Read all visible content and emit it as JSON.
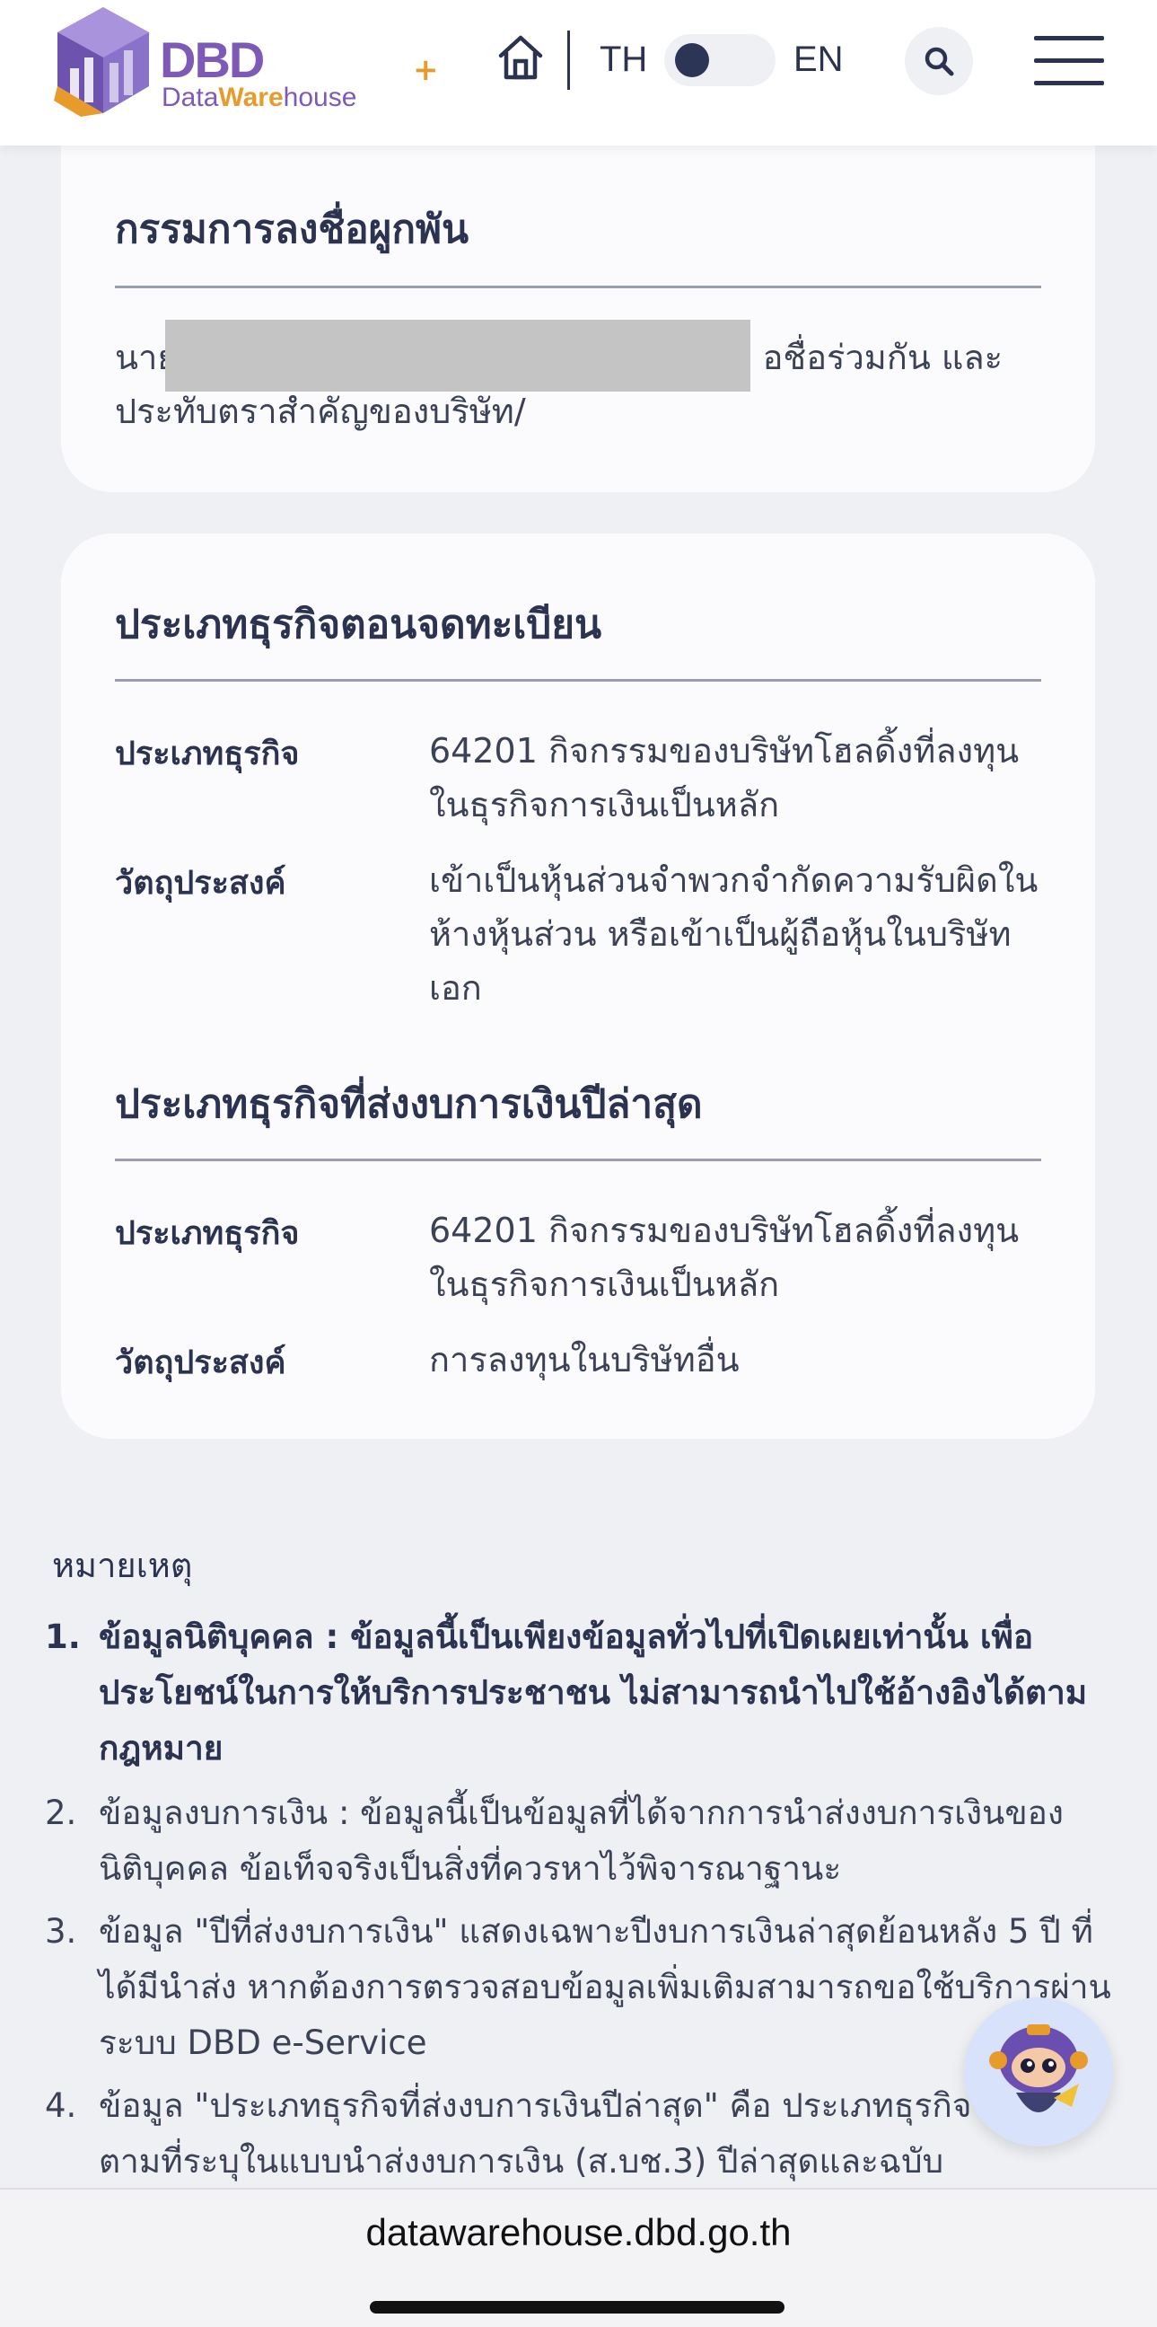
{
  "header": {
    "logo_dbd": "DBD",
    "logo_data": "ata",
    "logo_ware": "Ware",
    "logo_house": "house",
    "logo_plus": "+",
    "lang_th": "TH",
    "lang_en": "EN",
    "language_toggle_state": "TH"
  },
  "authorized_directors_card": {
    "title": "กรรมการลงชื่อผูกพัน",
    "text_prefix": "นาย",
    "text_suffix": "อชื่อร่วมกัน และ",
    "text_line2": "ประทับตราสำคัญของบริษัท/"
  },
  "business_type_card": {
    "registration_title": "ประเภทธุรกิจตอนจดทะเบียน",
    "registration_rows": [
      {
        "label": "ประเภทธุรกิจ",
        "value": "64201 กิจกรรมของบริษัทโฮลดิ้งที่ลงทุนในธุรกิจการเงินเป็นหลัก"
      },
      {
        "label": "วัตถุประสงค์",
        "value": "เข้าเป็นหุ้นส่วนจำพวกจำกัดความรับผิดในห้างหุ้นส่วน หรือเข้าเป็นผู้ถือหุ้นในบริษัทเอก"
      }
    ],
    "latest_title": "ประเภทธุรกิจที่ส่งงบการเงินปีล่าสุด",
    "latest_rows": [
      {
        "label": "ประเภทธุรกิจ",
        "value": "64201 กิจกรรมของบริษัทโฮลดิ้งที่ลงทุนในธุรกิจการเงินเป็นหลัก"
      },
      {
        "label": "วัตถุประสงค์",
        "value": "การลงทุนในบริษัทอื่น"
      }
    ]
  },
  "notes": {
    "title": "หมายเหตุ",
    "items": [
      {
        "num": "1.",
        "text": "ข้อมูลนิติบุคคล : ข้อมูลนี้เป็นเพียงข้อมูลทั่วไปที่เปิดเผยเท่านั้น เพื่อประโยชน์ในการให้บริการประชาชน ไม่สามารถนำไปใช้อ้างอิงได้ตามกฎหมาย"
      },
      {
        "num": "2.",
        "text": "ข้อมูลงบการเงิน : ข้อมูลนี้เป็นข้อมูลที่ได้จากการนำส่งงบการเงินของนิติบุคคล ข้อเท็จจริงเป็นสิ่งที่ควรหาไว้พิจารณาฐานะ"
      },
      {
        "num": "3.",
        "text": "ข้อมูล \"ปีที่ส่งงบการเงิน\" แสดงเฉพาะปีงบการเงินล่าสุดย้อนหลัง 5 ปี ที่ได้มีนำส่ง หากต้องการตรวจสอบข้อมูลเพิ่มเติมสามารถขอใช้บริการผ่านระบบ DBD e-Service"
      },
      {
        "num": "4.",
        "text": "ข้อมูล \"ประเภทธุรกิจที่ส่งงบการเงินปีล่าสุด\" คือ ประเภทธุรกิจ กิจการตามที่ระบุในแบบนำส่งงบการเงิน (ส.บช.3) ปีล่าสุดและฉบับ"
      }
    ]
  },
  "browser": {
    "url": "datawarehouse.dbd.go.th"
  }
}
